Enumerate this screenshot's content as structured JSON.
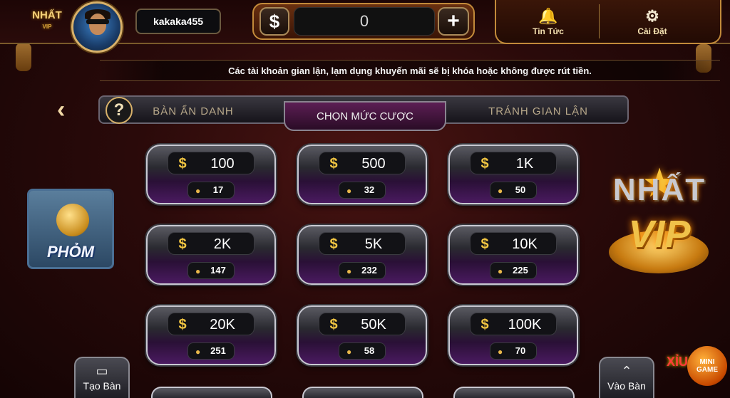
{
  "header": {
    "logo_text": "NHẤT",
    "logo_sub": "VIP",
    "username": "kakaka455",
    "balance_currency": "$",
    "balance": "0",
    "add_funds": "+",
    "menu": [
      {
        "label": "Tin Tức",
        "icon": "bell-icon",
        "glyph": "🔔"
      },
      {
        "label": "Cài Đặt",
        "icon": "gear-icon",
        "glyph": "⚙"
      }
    ]
  },
  "notice": "Các tài khoản gian lận, lạm dụng khuyến mãi sẽ bị khóa hoặc không được rút tiền.",
  "tabs": {
    "back": "‹",
    "help": "?",
    "items": [
      {
        "label": "BÀN ẨN DANH",
        "active": false
      },
      {
        "label": "CHỌN MỨC CƯỢC",
        "active": true
      },
      {
        "label": "TRÁNH GIAN LẬN",
        "active": false
      }
    ]
  },
  "game": {
    "name": "PHỎM"
  },
  "brand": {
    "line1": "NHẤT",
    "line2": "VIP"
  },
  "currency_symbol": "$",
  "bets": [
    {
      "value": "100",
      "players": "17"
    },
    {
      "value": "500",
      "players": "32"
    },
    {
      "value": "1K",
      "players": "50"
    },
    {
      "value": "2K",
      "players": "147"
    },
    {
      "value": "5K",
      "players": "232"
    },
    {
      "value": "10K",
      "players": "225"
    },
    {
      "value": "20K",
      "players": "251"
    },
    {
      "value": "50K",
      "players": "58"
    },
    {
      "value": "100K",
      "players": "70"
    }
  ],
  "bottom": {
    "create_table": "Tạo Bàn",
    "join_table": "Vào Bàn"
  },
  "minigame": {
    "xiu": "XỈU",
    "line1": "MINI",
    "line2": "GAME"
  }
}
